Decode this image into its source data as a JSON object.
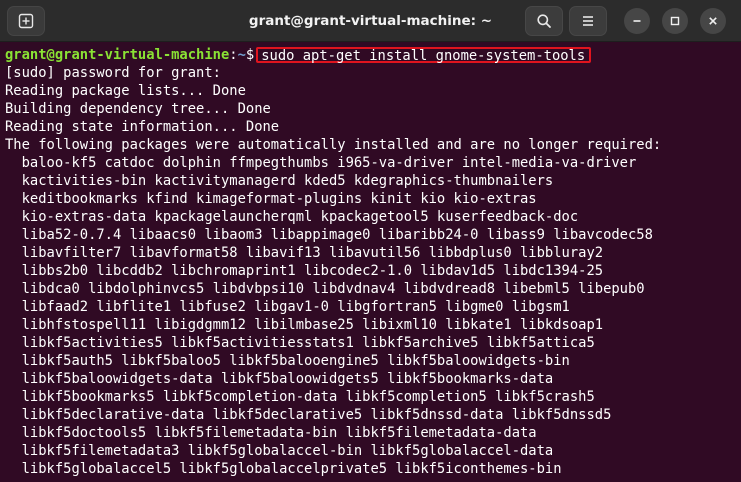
{
  "window": {
    "title": "grant@grant-virtual-machine: ~"
  },
  "prompt": {
    "user_host": "grant@grant-virtual-machine",
    "sep": ":",
    "path": "~",
    "symbol": "$",
    "command": "sudo apt-get install gnome-system-tools"
  },
  "output_lines": [
    "[sudo] password for grant:",
    "Reading package lists... Done",
    "Building dependency tree... Done",
    "Reading state information... Done",
    "The following packages were automatically installed and are no longer required:",
    "  baloo-kf5 catdoc dolphin ffmpegthumbs i965-va-driver intel-media-va-driver",
    "  kactivities-bin kactivitymanagerd kded5 kdegraphics-thumbnailers",
    "  keditbookmarks kfind kimageformat-plugins kinit kio kio-extras",
    "  kio-extras-data kpackagelauncherqml kpackagetool5 kuserfeedback-doc",
    "  liba52-0.7.4 libaacs0 libaom3 libappimage0 libaribb24-0 libass9 libavcodec58",
    "  libavfilter7 libavformat58 libavif13 libavutil56 libbdplus0 libbluray2",
    "  libbs2b0 libcddb2 libchromaprint1 libcodec2-1.0 libdav1d5 libdc1394-25",
    "  libdca0 libdolphinvcs5 libdvbpsi10 libdvdnav4 libdvdread8 libebml5 libepub0",
    "  libfaad2 libflite1 libfuse2 libgav1-0 libgfortran5 libgme0 libgsm1",
    "  libhfstospell11 libigdgmm12 libilmbase25 libixml10 libkate1 libkdsoap1",
    "  libkf5activities5 libkf5activitiesstats1 libkf5archive5 libkf5attica5",
    "  libkf5auth5 libkf5baloo5 libkf5balooengine5 libkf5baloowidgets-bin",
    "  libkf5baloowidgets-data libkf5baloowidgets5 libkf5bookmarks-data",
    "  libkf5bookmarks5 libkf5completion-data libkf5completion5 libkf5crash5",
    "  libkf5declarative-data libkf5declarative5 libkf5dnssd-data libkf5dnssd5",
    "  libkf5doctools5 libkf5filemetadata-bin libkf5filemetadata-data",
    "  libkf5filemetadata3 libkf5globalaccel-bin libkf5globalaccel-data",
    "  libkf5globalaccel5 libkf5globalaccelprivate5 libkf5iconthemes-bin"
  ],
  "icons": {
    "new_tab": "new-tab-icon",
    "search": "search-icon",
    "menu": "hamburger-menu-icon",
    "minimize": "minimize-icon",
    "maximize": "maximize-icon",
    "close": "close-icon"
  },
  "colors": {
    "terminal_bg": "#300a24",
    "prompt_user": "#8ae234",
    "prompt_path": "#729fcf",
    "text": "#ffffff",
    "highlight_box": "#e0141e"
  }
}
